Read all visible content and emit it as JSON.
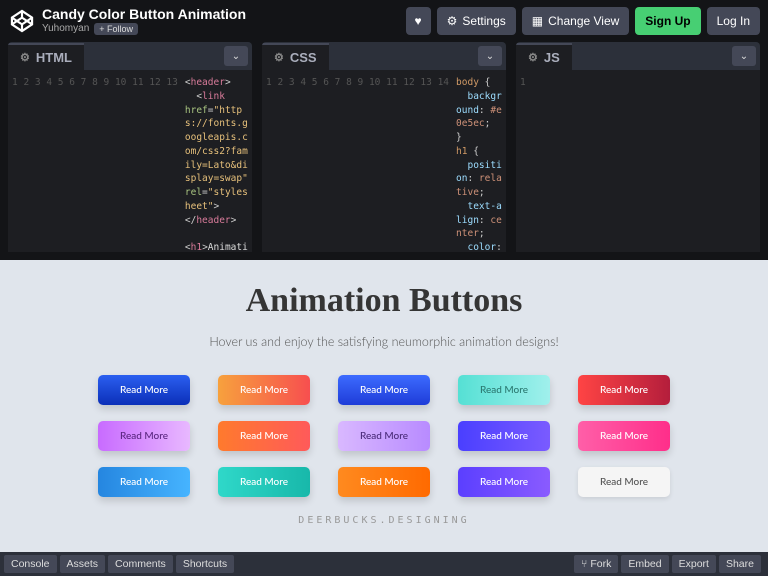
{
  "header": {
    "title": "Candy Color Button Animation",
    "author": "Yuhomyan",
    "follow": "+ Follow",
    "settings": "Settings",
    "change_view": "Change View",
    "sign_up": "Sign Up",
    "log_in": "Log In"
  },
  "panels": {
    "html_label": "HTML",
    "css_label": "CSS",
    "js_label": "JS"
  },
  "code": {
    "html_gutter": "1\n2\n3\n4\n5\n6\n7\n8\n9\n10\n11\n12\n13",
    "css_gutter": "1\n2\n3\n4\n5\n6\n7\n8\n9\n10\n11\n12\n13\n14",
    "js_gutter": "1"
  },
  "preview": {
    "heading": "Animation Buttons",
    "sub": "Hover us and enjoy the satisfying neumorphic animation designs!",
    "btn": "Read More",
    "credit": "DEERBUCKS.DESIGNING"
  },
  "footer": {
    "console": "Console",
    "assets": "Assets",
    "comments": "Comments",
    "shortcuts": "Shortcuts",
    "fork": "Fork",
    "embed": "Embed",
    "export": "Export",
    "share": "Share"
  }
}
